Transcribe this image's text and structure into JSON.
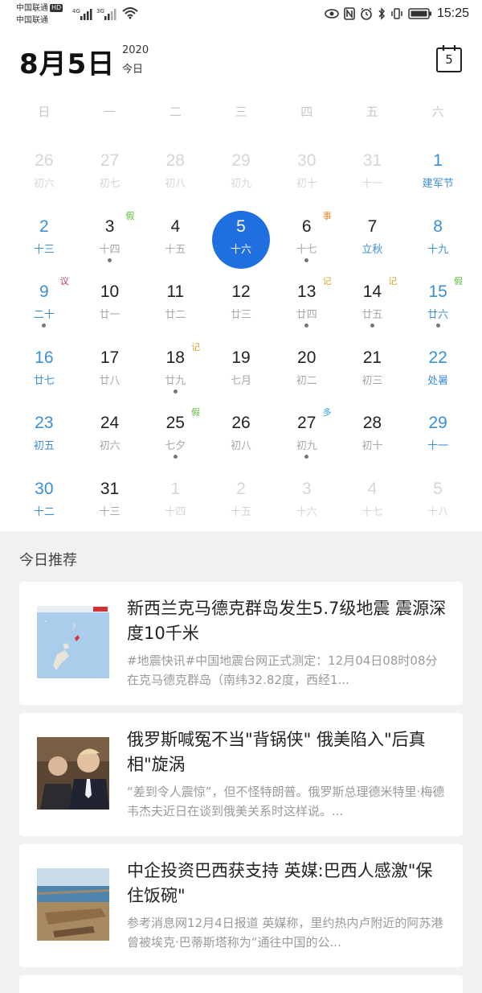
{
  "status_bar": {
    "carrier1": "中国联通",
    "hd_badge": "HD",
    "carrier2": "中国联通",
    "net1": "4G",
    "net2": "3G",
    "time": "15:25"
  },
  "header": {
    "date_title": "8月5日",
    "year": "2020",
    "today_label": "今日",
    "calendar_button_day": "5"
  },
  "calendar": {
    "weekdays": [
      "日",
      "一",
      "二",
      "三",
      "四",
      "五",
      "六"
    ],
    "weeks": [
      [
        {
          "num": "26",
          "lunar": "初六",
          "other": true
        },
        {
          "num": "27",
          "lunar": "初七",
          "other": true
        },
        {
          "num": "28",
          "lunar": "初八",
          "other": true
        },
        {
          "num": "29",
          "lunar": "初九",
          "other": true
        },
        {
          "num": "30",
          "lunar": "初十",
          "other": true
        },
        {
          "num": "31",
          "lunar": "十一",
          "other": true
        },
        {
          "num": "1",
          "lunar": "建军节"
        }
      ],
      [
        {
          "num": "2",
          "lunar": "十三"
        },
        {
          "num": "3",
          "lunar": "十四",
          "badge": "假",
          "dot": true
        },
        {
          "num": "4",
          "lunar": "十五"
        },
        {
          "num": "5",
          "lunar": "十六",
          "selected": true
        },
        {
          "num": "6",
          "lunar": "十七",
          "badge": "事",
          "dot": true
        },
        {
          "num": "7",
          "lunar": "立秋",
          "festival": true
        },
        {
          "num": "8",
          "lunar": "十九"
        }
      ],
      [
        {
          "num": "9",
          "lunar": "二十",
          "badge": "议",
          "dot": true
        },
        {
          "num": "10",
          "lunar": "廿一"
        },
        {
          "num": "11",
          "lunar": "廿二"
        },
        {
          "num": "12",
          "lunar": "廿三"
        },
        {
          "num": "13",
          "lunar": "廿四",
          "badge": "记",
          "dot": true
        },
        {
          "num": "14",
          "lunar": "廿五",
          "badge": "记",
          "dot": true
        },
        {
          "num": "15",
          "lunar": "廿六",
          "badge": "假",
          "dot": true
        }
      ],
      [
        {
          "num": "16",
          "lunar": "廿七"
        },
        {
          "num": "17",
          "lunar": "廿八"
        },
        {
          "num": "18",
          "lunar": "廿九",
          "badge": "记",
          "dot": true
        },
        {
          "num": "19",
          "lunar": "七月"
        },
        {
          "num": "20",
          "lunar": "初二"
        },
        {
          "num": "21",
          "lunar": "初三"
        },
        {
          "num": "22",
          "lunar": "处暑"
        }
      ],
      [
        {
          "num": "23",
          "lunar": "初五"
        },
        {
          "num": "24",
          "lunar": "初六"
        },
        {
          "num": "25",
          "lunar": "七夕",
          "badge": "假",
          "dot": true
        },
        {
          "num": "26",
          "lunar": "初八"
        },
        {
          "num": "27",
          "lunar": "初九",
          "badge": "多",
          "dot": true
        },
        {
          "num": "28",
          "lunar": "初十"
        },
        {
          "num": "29",
          "lunar": "十一"
        }
      ],
      [
        {
          "num": "30",
          "lunar": "十二"
        },
        {
          "num": "31",
          "lunar": "十三"
        },
        {
          "num": "1",
          "lunar": "十四",
          "other": true
        },
        {
          "num": "2",
          "lunar": "十五",
          "other": true
        },
        {
          "num": "3",
          "lunar": "十六",
          "other": true
        },
        {
          "num": "4",
          "lunar": "十七",
          "other": true
        },
        {
          "num": "5",
          "lunar": "十八",
          "other": true
        }
      ]
    ]
  },
  "badge_colors": {
    "假": "#5cbf3a",
    "事": "#e38b2c",
    "议": "#b53a6a",
    "记": "#d4a72c",
    "多": "#2ea0d8"
  },
  "colors": {
    "accent": "#1f6fe0",
    "weekend": "#3a8fd6"
  },
  "recommend": {
    "title": "今日推荐",
    "cards": [
      {
        "title": "新西兰克马德克群岛发生5.7级地震 震源深度10千米",
        "desc": "#地震快讯#中国地震台网正式测定：12月04日08时08分在克马德克群岛（南纬32.82度，西经1...",
        "thumb": "map-thumbnail"
      },
      {
        "title": "俄罗斯喊冤不当\"背锅侠\" 俄美陷入\"后真相\"旋涡",
        "desc": "“差到令人震惊”，但不怪特朗普。俄罗斯总理德米特里·梅德韦杰夫近日在谈到俄美关系时这样说。...",
        "thumb": "people-thumbnail"
      },
      {
        "title": "中企投资巴西获支持 英媒:巴西人感激\"保住饭碗\"",
        "desc": "参考消息网12月4日报道 英媒称，里约热内卢附近的阿苏港曾被埃克·巴蒂斯塔称为“通往中国的公...",
        "thumb": "port-thumbnail"
      }
    ]
  }
}
